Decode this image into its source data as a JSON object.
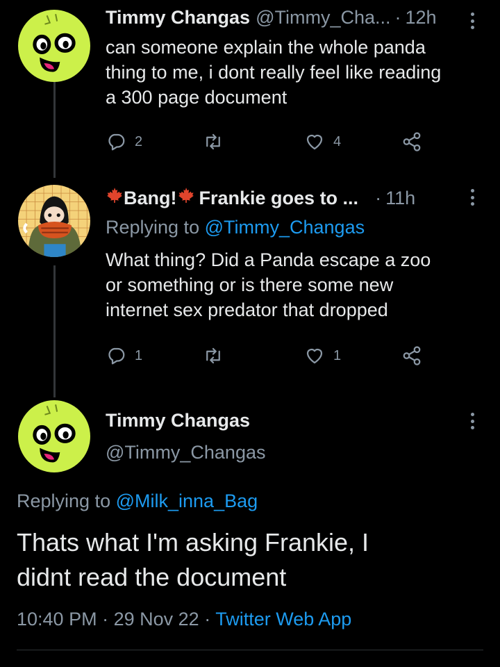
{
  "tweet1": {
    "name": "Timmy Changas",
    "handle": "@Timmy_Cha...",
    "separator": "·",
    "time": "12h",
    "text_lines": [
      "can someone explain the whole panda",
      "thing to me, i dont really feel like reading",
      "a 300 page document"
    ],
    "reply_count": "2",
    "like_count": "4"
  },
  "tweet2": {
    "name_part1": "Bang!",
    "name_part2": "Frankie goes to ...",
    "separator": "·",
    "time": "11h",
    "replying_label": "Replying to",
    "replying_handle": "@Timmy_Changas",
    "text_lines": [
      "What thing? Did a Panda escape a zoo",
      "or something or is there some new",
      "internet sex predator that dropped"
    ],
    "reply_count": "1",
    "like_count": "1"
  },
  "main_tweet": {
    "name": "Timmy Changas",
    "handle": "@Timmy_Changas",
    "replying_label": "Replying to",
    "replying_handle": "@Milk_inna_Bag",
    "text_lines": [
      "Thats what I'm asking Frankie, I",
      "didnt read the document"
    ],
    "time": "10:40 PM",
    "separator1": "·",
    "date": "29 Nov 22",
    "separator2": "·",
    "source": "Twitter Web App"
  },
  "icons": {
    "reply": "reply-icon",
    "retweet": "retweet-icon",
    "like": "heart-icon",
    "share": "share-icon",
    "more": "more-vertical-icon",
    "leaf": "maple-leaf-icon"
  },
  "colors": {
    "background": "#000000",
    "text": "#e7e9ea",
    "secondary": "#8b98a5",
    "link": "#1d9bf0",
    "avatar_green": "#ccf04a",
    "maple_leaf": "#e0442c"
  }
}
